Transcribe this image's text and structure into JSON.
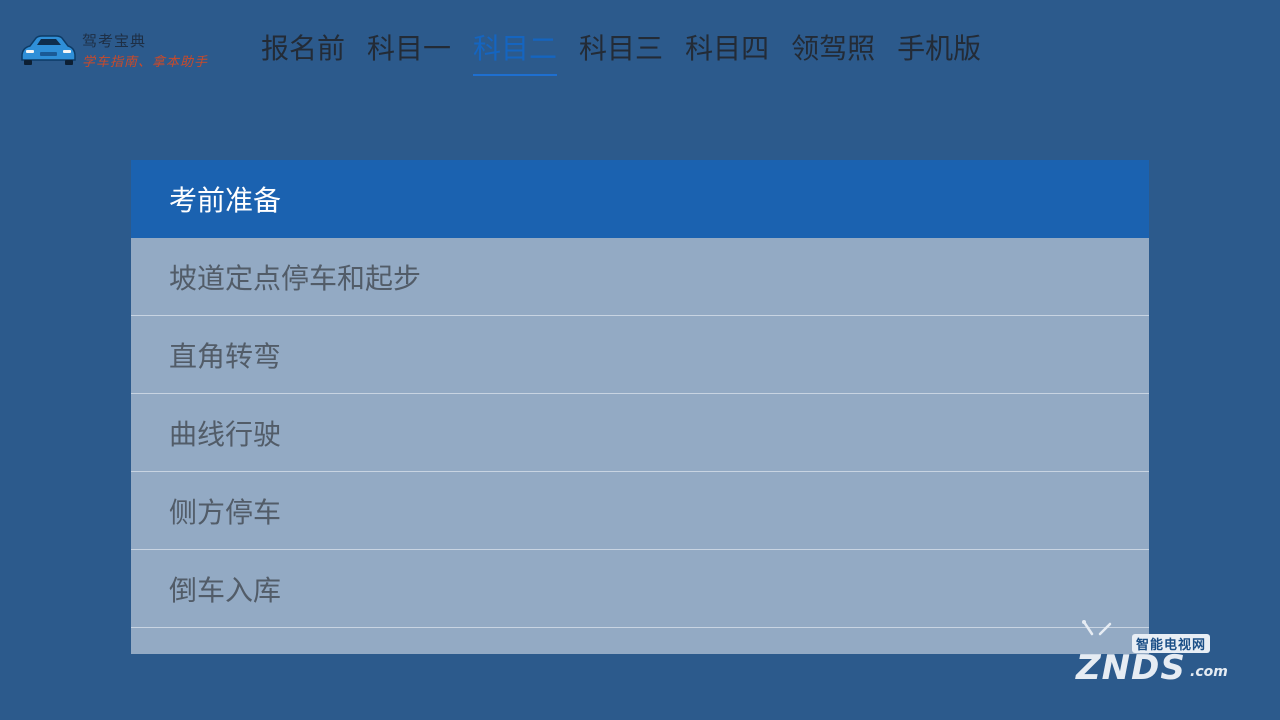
{
  "logo": {
    "title": "驾考宝典",
    "slogan": "学车指南、拿本助手",
    "icon": "car-icon"
  },
  "nav": {
    "tabs": [
      {
        "label": "报名前",
        "active": false
      },
      {
        "label": "科目一",
        "active": false
      },
      {
        "label": "科目二",
        "active": true
      },
      {
        "label": "科目三",
        "active": false
      },
      {
        "label": "科目四",
        "active": false
      },
      {
        "label": "领驾照",
        "active": false
      },
      {
        "label": "手机版",
        "active": false
      }
    ]
  },
  "menu": {
    "items": [
      {
        "label": "考前准备",
        "active": true
      },
      {
        "label": "坡道定点停车和起步",
        "active": false
      },
      {
        "label": "直角转弯",
        "active": false
      },
      {
        "label": "曲线行驶",
        "active": false
      },
      {
        "label": "侧方停车",
        "active": false
      },
      {
        "label": "倒车入库",
        "active": false
      }
    ]
  },
  "watermark": {
    "top": "智能电视网",
    "main": "ZNDS",
    "suffix": ".com"
  },
  "colors": {
    "background": "#2c5a8c",
    "accent": "#1565c0",
    "selected_row": "#1b62b0",
    "panel": "#93aac4"
  }
}
